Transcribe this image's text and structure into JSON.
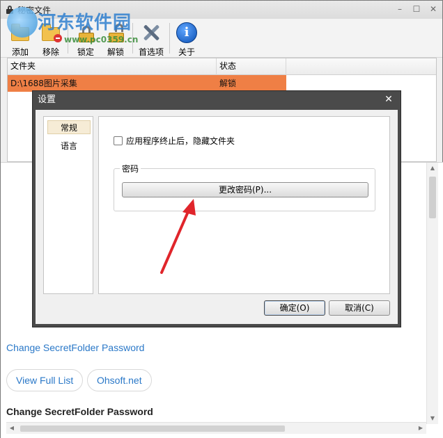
{
  "app": {
    "title": "秘密文件",
    "minimize_glyph": "–",
    "maximize_glyph": "☐",
    "close_glyph": "✕"
  },
  "watermark": {
    "text": "河东软件园",
    "url": "www.pc0359.cn"
  },
  "toolbar": {
    "items": [
      {
        "label": "添加",
        "icon": "folder-add-icon"
      },
      {
        "label": "移除",
        "icon": "folder-remove-icon"
      },
      {
        "label": "锁定",
        "icon": "lock-icon"
      },
      {
        "label": "解锁",
        "icon": "unlock-icon"
      },
      {
        "label": "首选项",
        "icon": "tools-icon"
      },
      {
        "label": "关于",
        "icon": "info-icon"
      }
    ]
  },
  "folder_list": {
    "columns": [
      "文件夹",
      "状态"
    ],
    "rows": [
      {
        "folder": "D:\\1688图片采集",
        "status": "解锁",
        "highlight": "#ef7f45"
      }
    ]
  },
  "help_page": {
    "link_title": "Change SecretFolder Password",
    "pills": [
      "View Full List",
      "Ohsoft.net"
    ],
    "heading": "Change SecretFolder Password"
  },
  "dialog": {
    "title": "设置",
    "close_glyph": "✕",
    "nav_items": [
      "常规",
      "语言"
    ],
    "selected_nav": "常规",
    "checkbox_label": "应用程序终止后，隐藏文件夹",
    "checkbox_checked": false,
    "group_title": "密码",
    "change_password_button": "更改密码(P)...",
    "ok_button": "确定(O)",
    "cancel_button": "取消(C)"
  },
  "colors": {
    "row_highlight": "#ef7f45",
    "link": "#2a78c8",
    "annotation_arrow": "#e0252b"
  }
}
